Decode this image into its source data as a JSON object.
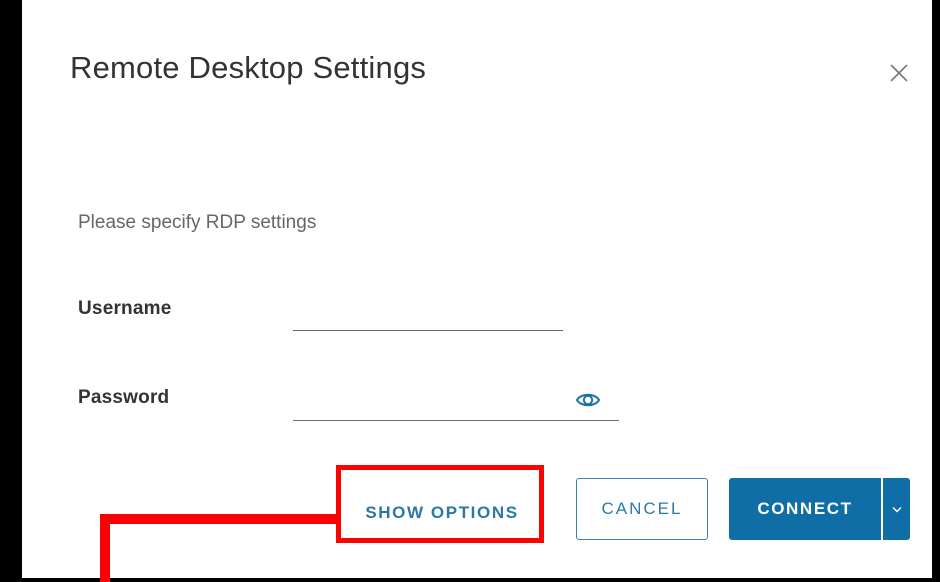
{
  "dialog": {
    "title": "Remote Desktop Settings",
    "close_icon": "close-icon",
    "subtitle": "Please specify RDP settings"
  },
  "form": {
    "username_label": "Username",
    "username_value": "",
    "password_label": "Password",
    "password_value": "",
    "password_toggle_icon": "eye-icon"
  },
  "actions": {
    "show_options_label": "SHOW OPTIONS",
    "cancel_label": "CANCEL",
    "connect_label": "CONNECT",
    "connect_menu_icon": "chevron-down-icon"
  },
  "colors": {
    "primary": "#0f6ea5",
    "link": "#2c78a4",
    "annotation": "#ff0000"
  }
}
